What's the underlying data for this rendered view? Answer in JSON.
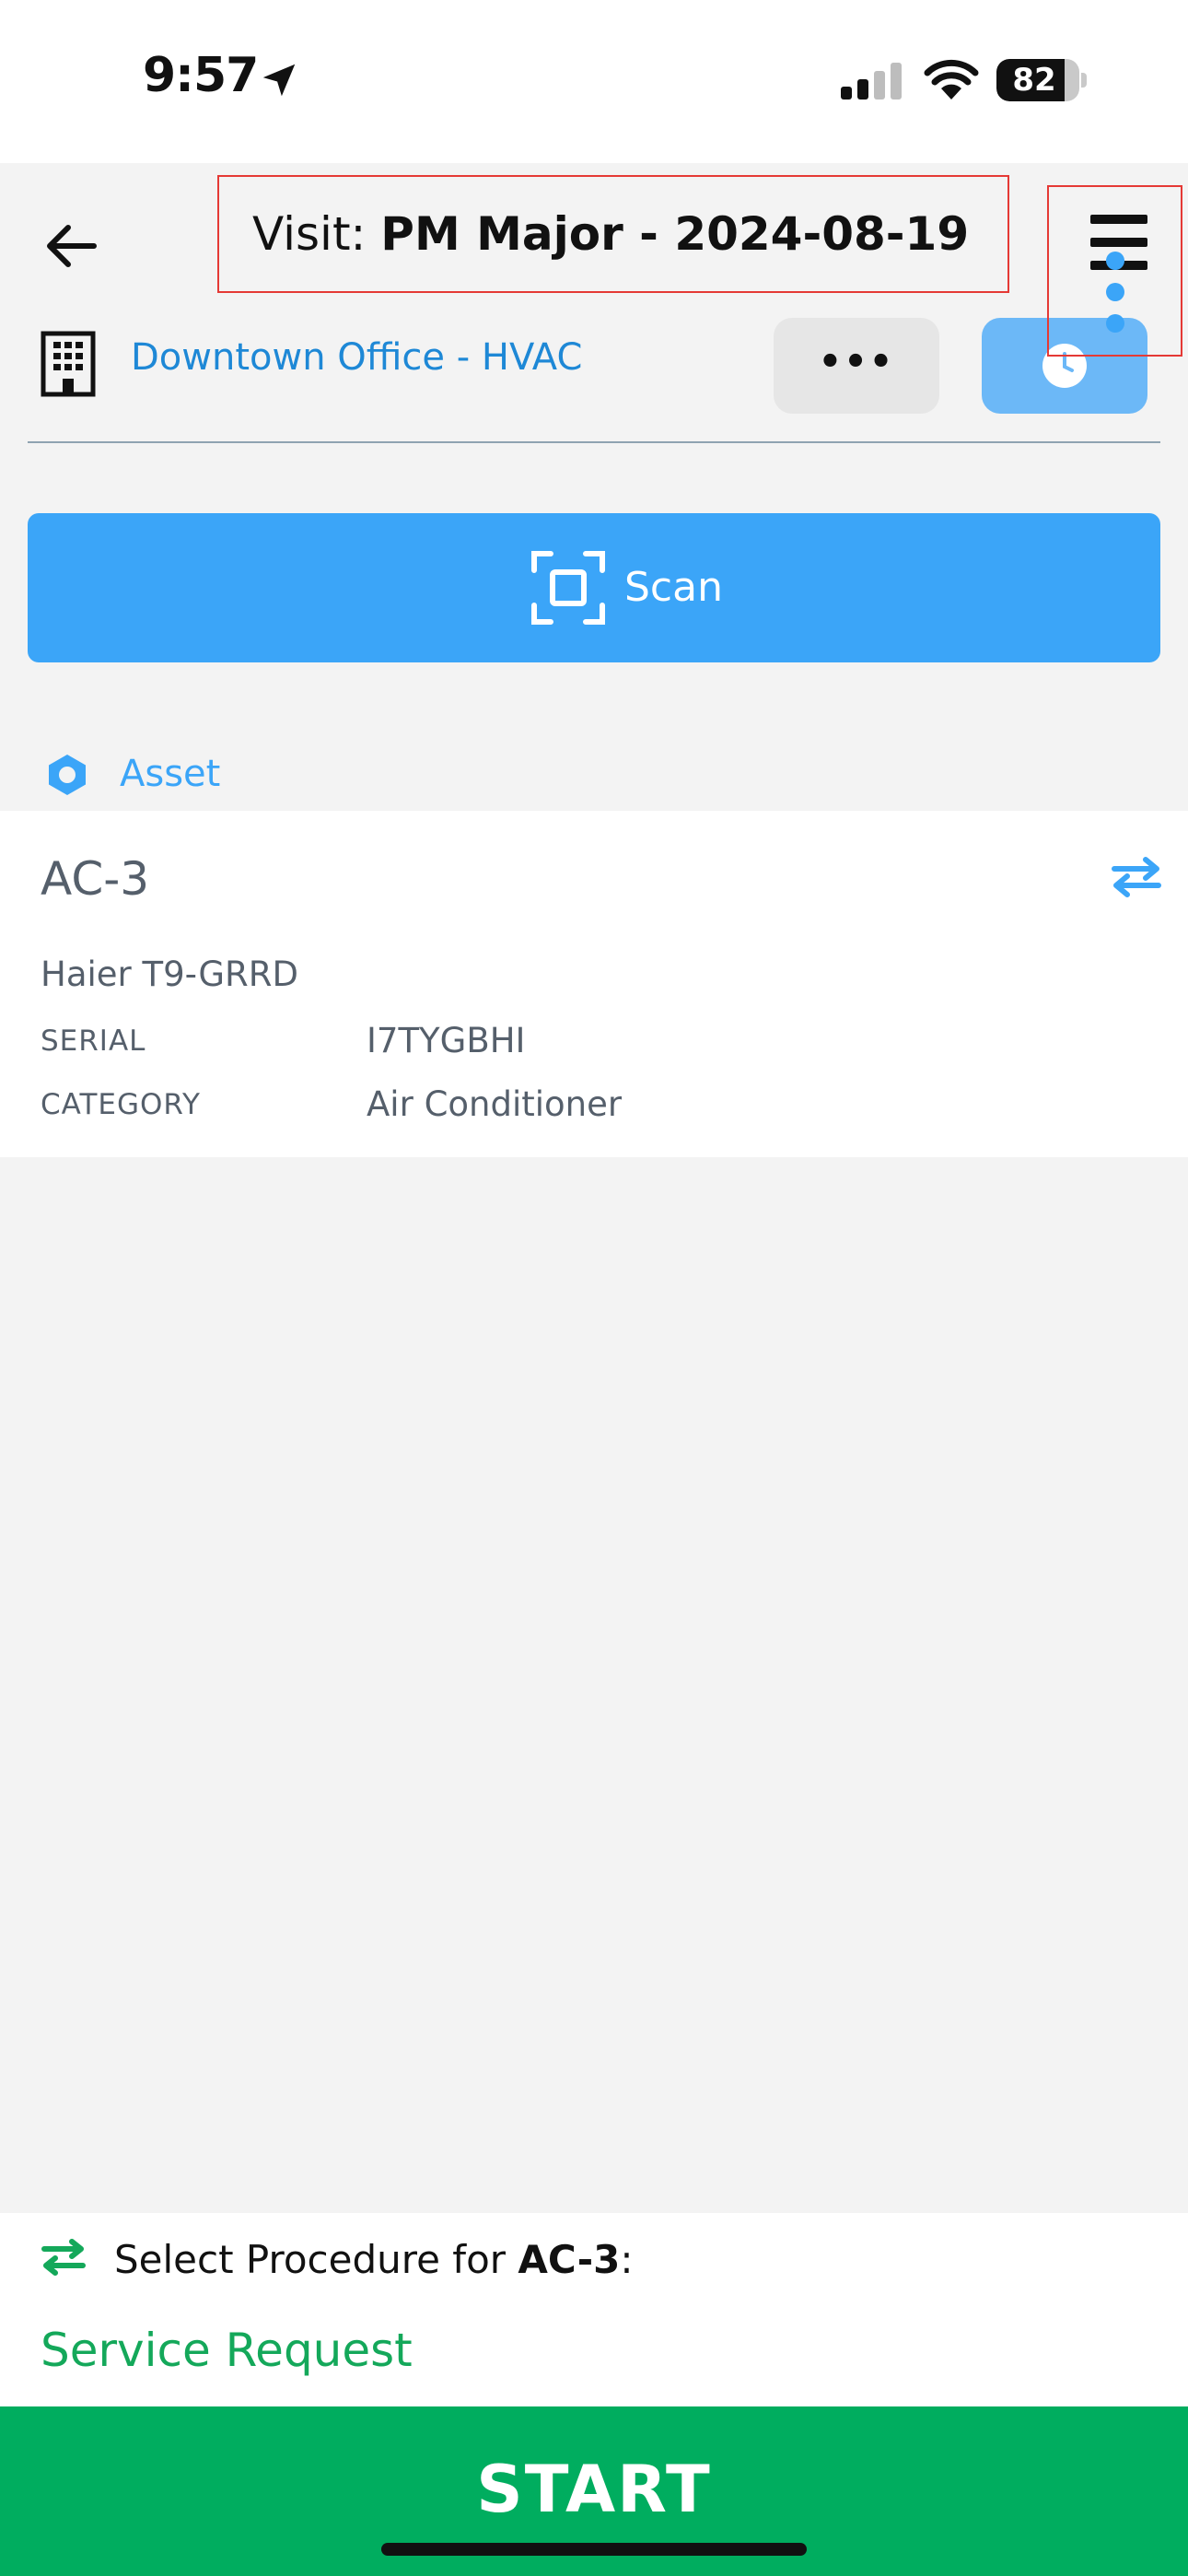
{
  "status_bar": {
    "time": "9:57",
    "battery": "82",
    "battery_level": 0.82
  },
  "header": {
    "title_prefix": "Visit: ",
    "title_main": "PM Major - 2024-08-19",
    "site_name": "Downtown Office - HVAC",
    "more_label": "•••"
  },
  "scan": {
    "label": "Scan"
  },
  "asset_section": {
    "label": "Asset",
    "asset": {
      "name": "AC-3",
      "model": "Haier T9-GRRD",
      "fields": [
        {
          "label": "SERIAL",
          "value": "I7TYGBHI"
        },
        {
          "label": "CATEGORY",
          "value": "Air Conditioner"
        }
      ]
    }
  },
  "procedure": {
    "prompt_prefix": "Select Procedure for ",
    "prompt_asset": "AC-3",
    "prompt_suffix": ":",
    "selected": "Service Request"
  },
  "footer": {
    "start_label": "START"
  },
  "colors": {
    "accent_blue": "#3ba5f8",
    "link_blue": "#1e88d6",
    "green": "#00ad5f",
    "highlight_red": "#e53935"
  }
}
